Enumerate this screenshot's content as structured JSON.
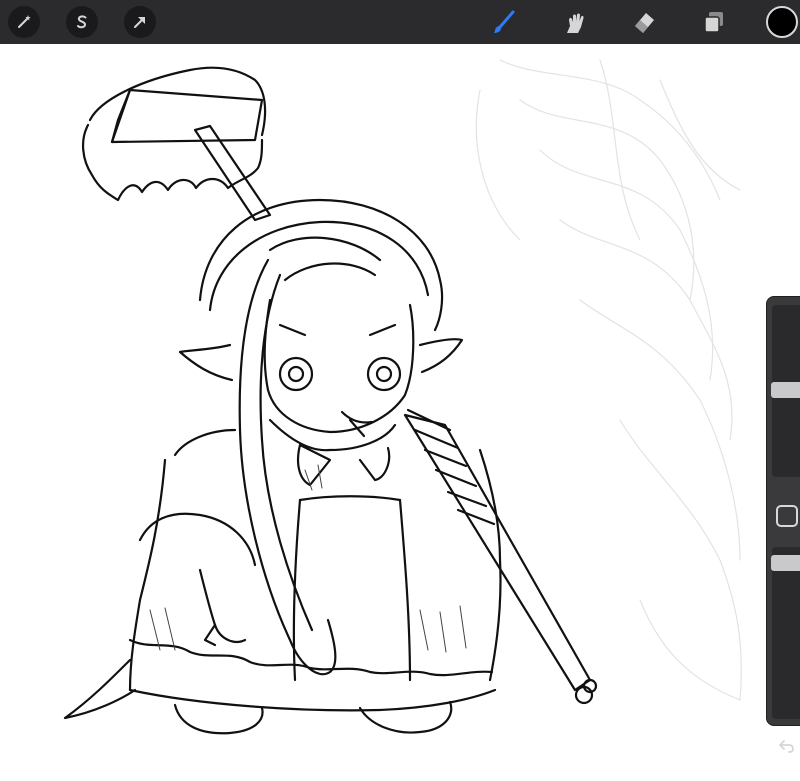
{
  "toolbar": {
    "left_tools": [
      {
        "name": "adjustments-icon"
      },
      {
        "name": "selection-icon"
      },
      {
        "name": "transform-icon"
      }
    ],
    "right_tools": [
      {
        "name": "brush-icon",
        "active": true
      },
      {
        "name": "smudge-icon",
        "active": false
      },
      {
        "name": "eraser-icon",
        "active": false
      },
      {
        "name": "layers-icon",
        "active": false
      }
    ],
    "current_color": "#000000",
    "active_color": "#2f7bf5",
    "icon_color": "#d6d6d6"
  },
  "sidebar": {
    "brush_size_level": 0.17,
    "opacity_level": 0.04
  }
}
